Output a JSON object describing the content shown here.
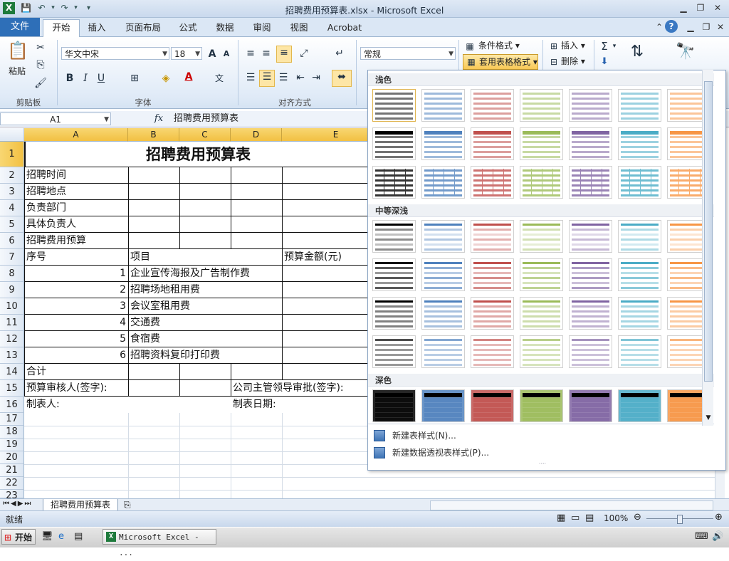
{
  "window": {
    "title": "招聘费用预算表.xlsx - Microsoft Excel"
  },
  "tabs": [
    "文件",
    "开始",
    "插入",
    "页面布局",
    "公式",
    "数据",
    "审阅",
    "视图",
    "Acrobat"
  ],
  "ribbon": {
    "clipboard": {
      "paste_label": "粘贴",
      "group_label": "剪贴板"
    },
    "font": {
      "font_name": "华文中宋",
      "font_size": "18",
      "group_label": "字体"
    },
    "align": {
      "group_label": "对齐方式"
    },
    "number": {
      "format": "常规"
    },
    "styles": {
      "conditional": "条件格式",
      "table_format": "套用表格格式"
    },
    "cells": {
      "insert": "插入",
      "delete": "删除"
    }
  },
  "formula_bar": {
    "name_box": "A1",
    "fx": "fx",
    "content": "招聘费用预算表"
  },
  "sheet": {
    "columns": [
      "A",
      "B",
      "C",
      "D",
      "E"
    ],
    "rows": [
      "1",
      "2",
      "3",
      "4",
      "5",
      "6",
      "7",
      "8",
      "9",
      "10",
      "11",
      "12",
      "13",
      "14",
      "15",
      "16",
      "17",
      "18",
      "19",
      "20",
      "21",
      "22",
      "23"
    ],
    "cells": {
      "title": "招聘费用预算表",
      "r2": "招聘时间",
      "r3": "招聘地点",
      "r4": "负责部门",
      "r5": "具体负责人",
      "r6": "招聘费用预算",
      "r7a": "序号",
      "r7b": "项目",
      "r7e": "预算金额(元)",
      "r8n": "1",
      "r8": "企业宣传海报及广告制作费",
      "r9n": "2",
      "r9": "招聘场地租用费",
      "r10n": "3",
      "r10": "会议室租用费",
      "r11n": "4",
      "r11": "交通费",
      "r12n": "5",
      "r12": "食宿费",
      "r13n": "6",
      "r13": "招聘资料复印打印费",
      "r14": "合计",
      "r15a": "预算审核人(签字):",
      "r15d": "公司主管领导审批(签字):",
      "r16a": "制表人:",
      "r16d": "制表日期:"
    },
    "sheet_tab": "招聘费用预算表"
  },
  "gallery": {
    "sections": [
      "浅色",
      "中等深浅",
      "深色"
    ],
    "menu": [
      "新建表样式(N)...",
      "新建数据透视表样式(P)..."
    ],
    "colors": [
      "#000000",
      "#4f81bd",
      "#c0504d",
      "#9bbb59",
      "#8064a2",
      "#4bacc6",
      "#f79646"
    ]
  },
  "status": {
    "ready": "就绪",
    "zoom": "100%"
  },
  "taskbar": {
    "start": "开始",
    "app": "Microsoft Excel - ..."
  }
}
